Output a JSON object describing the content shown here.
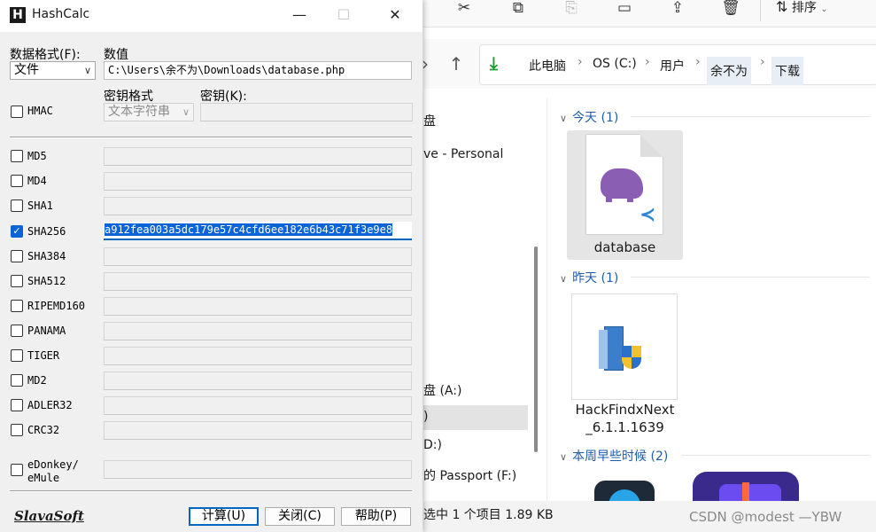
{
  "explorer": {
    "toolbar": {
      "icons": [
        "cut-icon",
        "copy-icon",
        "paste-icon",
        "rename-icon",
        "share-icon",
        "delete-icon"
      ],
      "sort_label": "排序"
    },
    "breadcrumb": [
      "此电脑",
      "OS (C:)",
      "用户",
      "余不为",
      "下载"
    ],
    "nav_items": [
      "盘",
      "ve - Personal",
      "盘 (A:)",
      ")",
      "D:)",
      "的 Passport (F:)"
    ],
    "groups": [
      {
        "label": "今天 (1)",
        "files": [
          "database"
        ]
      },
      {
        "label": "昨天 (1)",
        "files": [
          "HackFindxNext_6.1.1.1639"
        ]
      },
      {
        "label": "本周早些时候 (2)",
        "files": []
      }
    ],
    "file_name_lines": {
      "database": [
        "database"
      ],
      "hackfind": [
        "HackFindxNext",
        "_6.1.1.1639"
      ]
    },
    "status": "选中 1 个项目  1.89 KB",
    "watermark": "CSDN @modest —YBW"
  },
  "hashcalc": {
    "title": "HashCalc",
    "data_format_label": "数据格式(F):",
    "data_format_value": "文件",
    "data_label": "数值",
    "data_value": "C:\\Users\\余不为\\Downloads\\database.php",
    "hmac_label": "HMAC",
    "hmac_checked": false,
    "key_format_label": "密钥格式",
    "key_format_value": "文本字符串",
    "key_label": "密钥(K):",
    "key_value": "",
    "algorithms": [
      {
        "name": "MD5",
        "checked": false,
        "value": ""
      },
      {
        "name": "MD4",
        "checked": false,
        "value": ""
      },
      {
        "name": "SHA1",
        "checked": false,
        "value": ""
      },
      {
        "name": "SHA256",
        "checked": true,
        "value": "a912fea003a5dc179e57c4cfd6ee182e6b43c71f3e9e8"
      },
      {
        "name": "SHA384",
        "checked": false,
        "value": ""
      },
      {
        "name": "SHA512",
        "checked": false,
        "value": ""
      },
      {
        "name": "RIPEMD160",
        "checked": false,
        "value": ""
      },
      {
        "name": "PANAMA",
        "checked": false,
        "value": ""
      },
      {
        "name": "TIGER",
        "checked": false,
        "value": ""
      },
      {
        "name": "MD2",
        "checked": false,
        "value": ""
      },
      {
        "name": "ADLER32",
        "checked": false,
        "value": ""
      },
      {
        "name": "CRC32",
        "checked": false,
        "value": ""
      }
    ],
    "edonkey_label_1": "eDonkey/",
    "edonkey_label_2": "eMule",
    "edonkey_checked": false,
    "edonkey_value": "",
    "brand": "SlavaSoft",
    "buttons": {
      "calculate": "计算(U)",
      "close": "关闭(C)",
      "help": "帮助(P)"
    },
    "window_buttons": {
      "minimize": "—",
      "maximize": "☐",
      "close": "✕"
    }
  },
  "colors": {
    "accent": "#0067c0",
    "selection": "#0a64d6",
    "link_blue": "#1f5da9",
    "php_purple": "#8a5fb3",
    "vscode_blue": "#2f86d6"
  }
}
